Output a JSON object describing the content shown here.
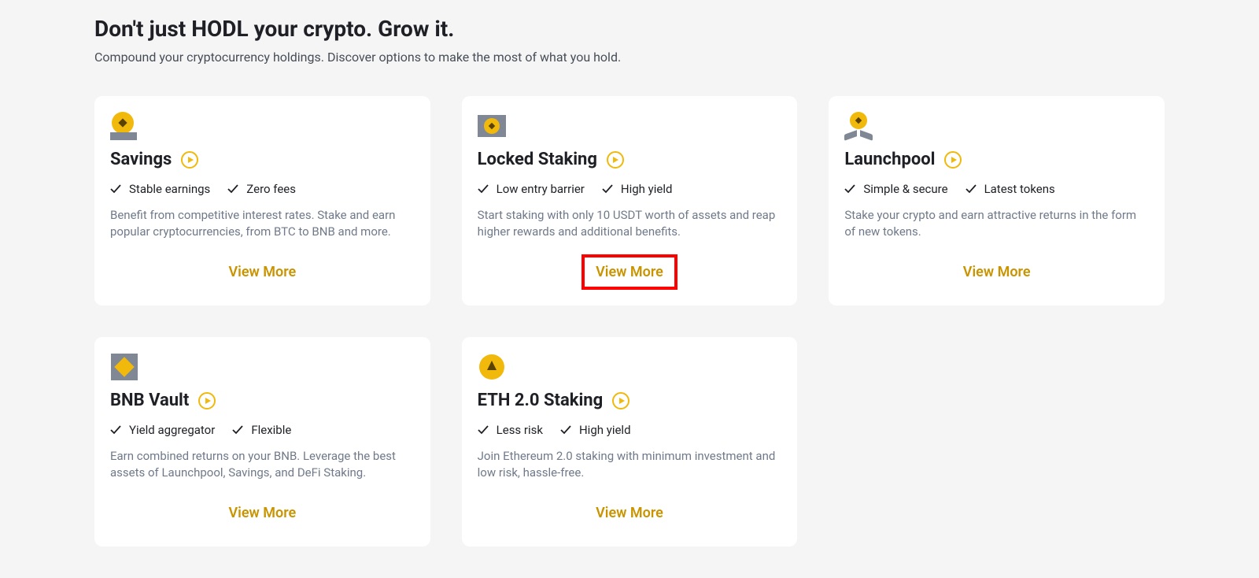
{
  "heading": "Don't just HODL your crypto. Grow it.",
  "subheading": "Compound your cryptocurrency holdings. Discover options to make the most of what you hold.",
  "view_more_label": "View More",
  "cards": [
    {
      "title": "Savings",
      "feat1": "Stable earnings",
      "feat2": "Zero fees",
      "desc": "Benefit from competitive interest rates. Stake and earn popular cryptocurrencies, from BTC to BNB and more."
    },
    {
      "title": "Locked Staking",
      "feat1": "Low entry barrier",
      "feat2": "High yield",
      "desc": "Start staking with only 10 USDT worth of assets and reap higher rewards and additional benefits."
    },
    {
      "title": "Launchpool",
      "feat1": "Simple & secure",
      "feat2": "Latest tokens",
      "desc": "Stake your crypto and earn attractive returns in the form of new tokens."
    },
    {
      "title": "BNB Vault",
      "feat1": "Yield aggregator",
      "feat2": "Flexible",
      "desc": "Earn combined returns on your BNB. Leverage the best assets of Launchpool, Savings, and DeFi Staking."
    },
    {
      "title": "ETH 2.0 Staking",
      "feat1": "Less risk",
      "feat2": "High yield",
      "desc": "Join Ethereum 2.0 staking with minimum investment and low risk, hassle-free."
    }
  ]
}
